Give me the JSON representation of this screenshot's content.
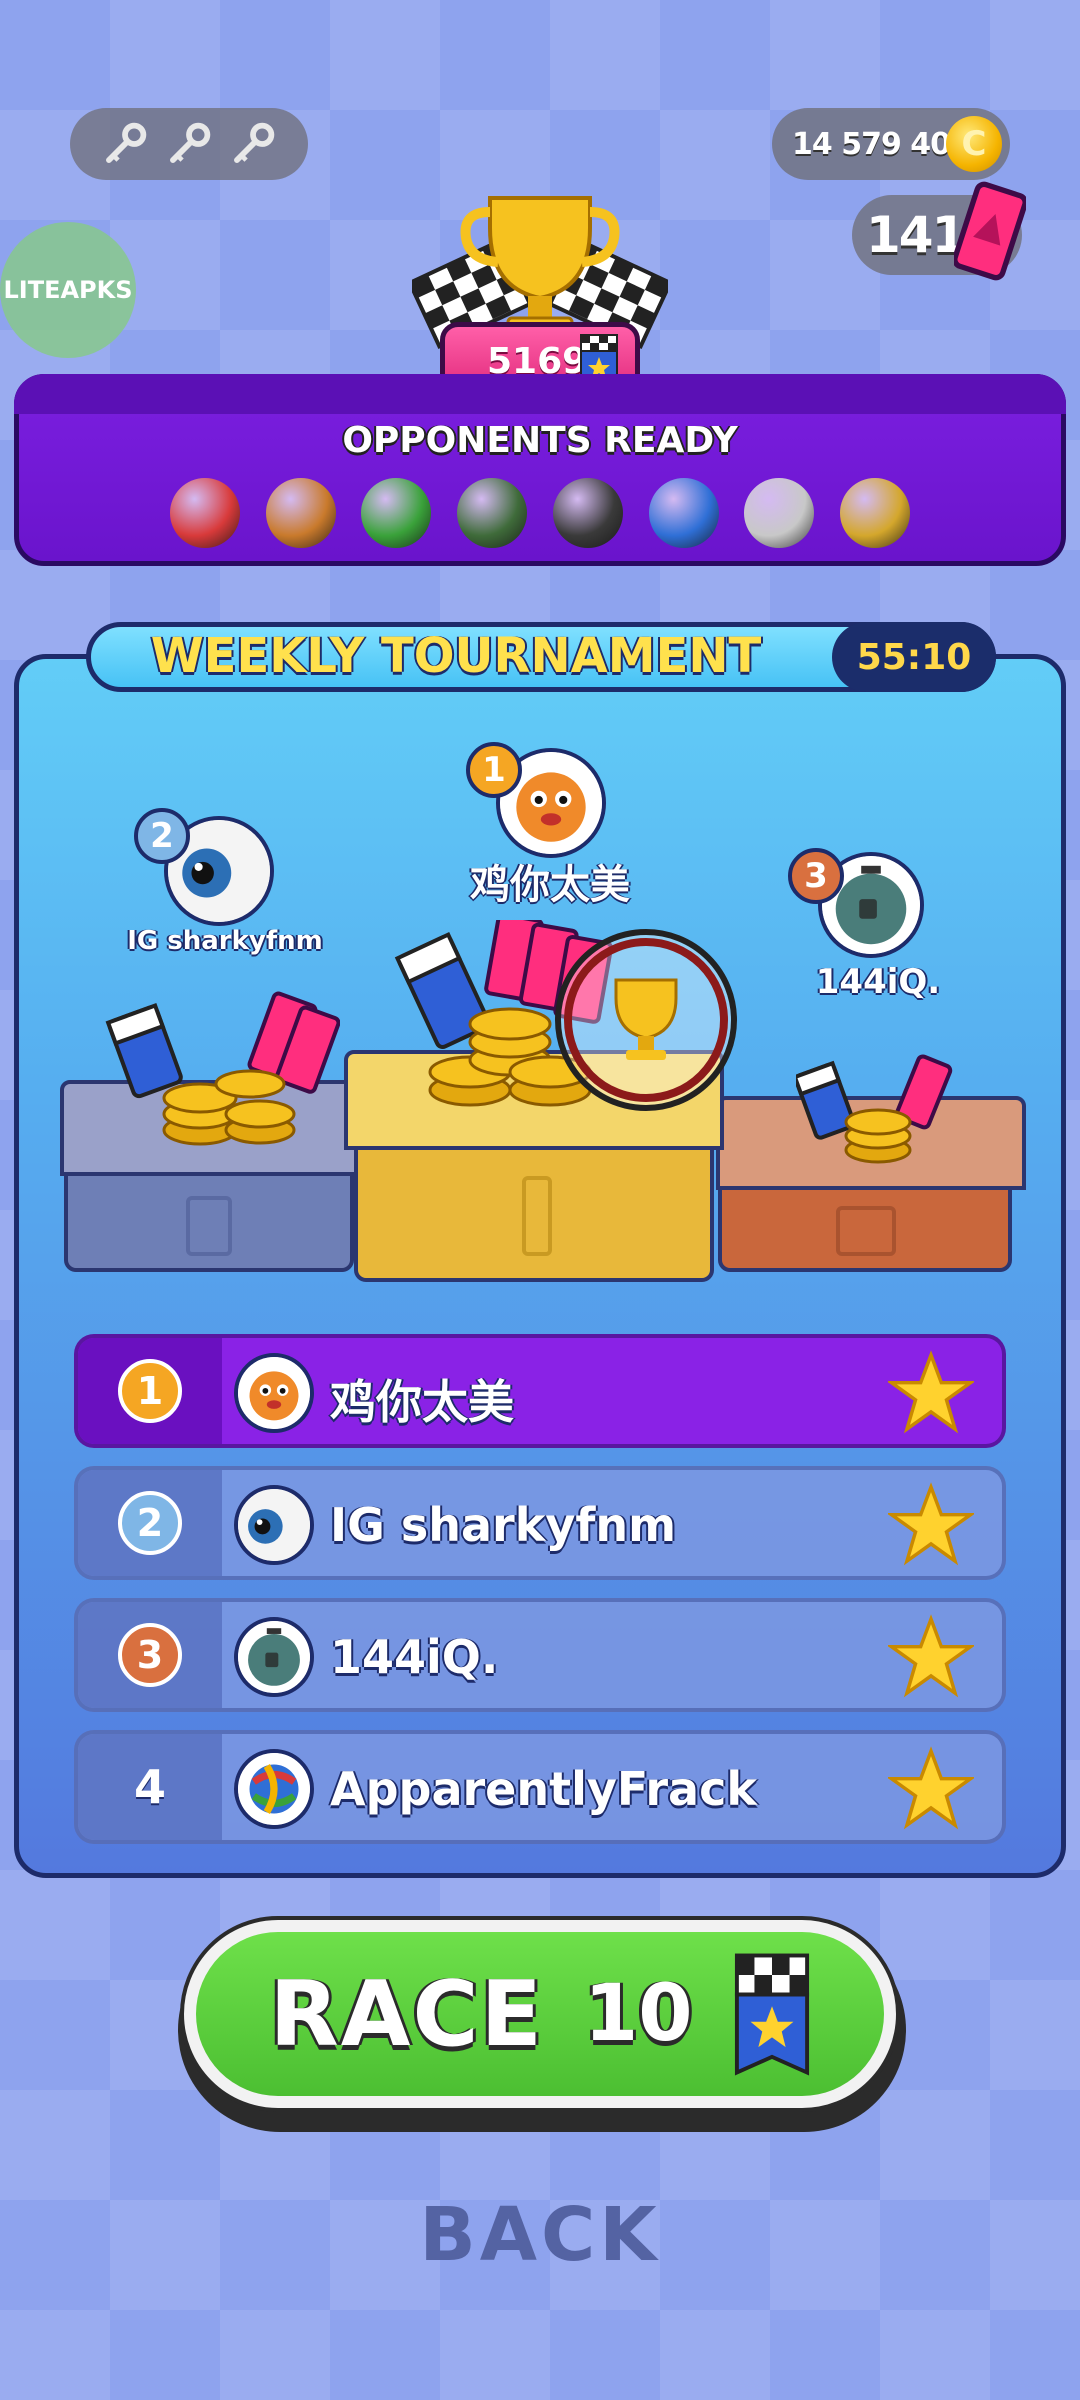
{
  "top_bar": {
    "keys": [
      "key-icon",
      "key-icon",
      "key-icon"
    ],
    "coins": "14 579 406",
    "coin_glyph": "C",
    "tickets": "141"
  },
  "watermark": "LITEAPKS",
  "trophy_score": "5169",
  "opponents": {
    "title": "OPPONENTS READY",
    "balls": [
      {
        "icon": "beachball-ball-icon",
        "color": "#d83a3a"
      },
      {
        "icon": "burger-ball-icon",
        "color": "#c97a2c"
      },
      {
        "icon": "watermelon-ball-icon",
        "color": "#3aa23a"
      },
      {
        "icon": "soccer-ball-icon",
        "color": "#3f6b3a"
      },
      {
        "icon": "bowling-ball-icon",
        "color": "#3a3a3a"
      },
      {
        "icon": "candy-ball-icon",
        "color": "#2f6fd6"
      },
      {
        "icon": "tire-ball-icon",
        "color": "#c8c8c8"
      },
      {
        "icon": "patterned-ball-icon",
        "color": "#d4a72c"
      }
    ]
  },
  "tournament": {
    "title": "WEEKLY TOURNAMENT",
    "timer": "55:10"
  },
  "podium": {
    "first": {
      "rank": "1",
      "name": "鸡你太美"
    },
    "second": {
      "rank": "2",
      "name": "IG sharkyfnm"
    },
    "third": {
      "rank": "3",
      "name": "144iQ."
    }
  },
  "leaderboard": [
    {
      "rank": "1",
      "name": "鸡你太美",
      "avatar": "pufferfish-avatar-icon"
    },
    {
      "rank": "2",
      "name": "IG sharkyfnm",
      "avatar": "eyeball-avatar-icon"
    },
    {
      "rank": "3",
      "name": "144iQ.",
      "avatar": "robot-avatar-icon"
    },
    {
      "rank": "4",
      "name": "ApparentlyFrack",
      "avatar": "knot-avatar-icon"
    }
  ],
  "race_button": {
    "label": "RACE",
    "cost": "10"
  },
  "back_button": {
    "label": "BACK"
  },
  "colors": {
    "gold": "#f5b400",
    "silver": "#7fb6e6",
    "bronze": "#d9703f",
    "star": "#ffd22e"
  }
}
